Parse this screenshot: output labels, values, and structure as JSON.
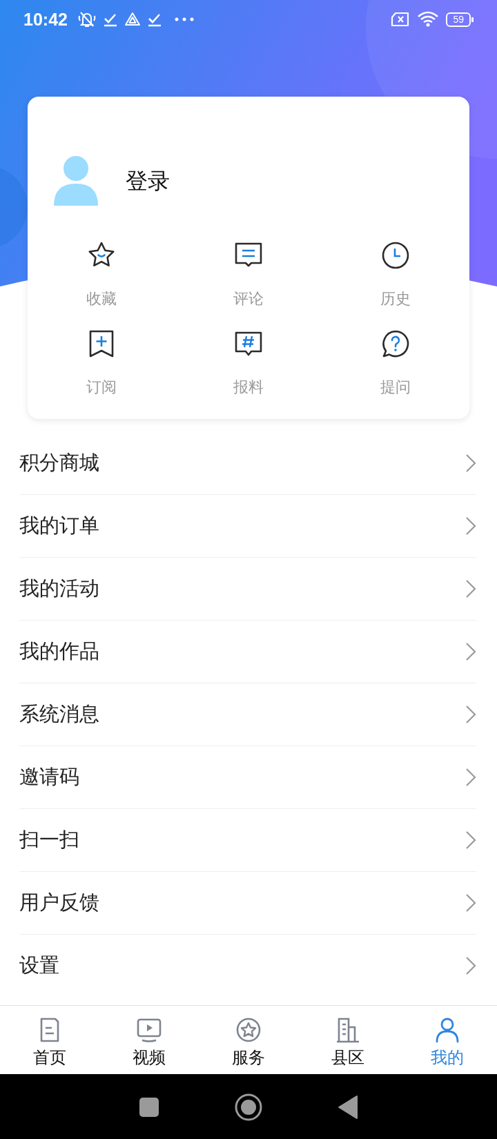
{
  "status_bar": {
    "time": "10:42",
    "battery": "59"
  },
  "profile": {
    "login": "登录"
  },
  "shortcuts": [
    {
      "label": "收藏"
    },
    {
      "label": "评论"
    },
    {
      "label": "历史"
    },
    {
      "label": "订阅"
    },
    {
      "label": "报料"
    },
    {
      "label": "提问"
    }
  ],
  "menu": [
    {
      "label": "积分商城"
    },
    {
      "label": "我的订单"
    },
    {
      "label": "我的活动"
    },
    {
      "label": "我的作品"
    },
    {
      "label": "系统消息"
    },
    {
      "label": "邀请码"
    },
    {
      "label": "扫一扫"
    },
    {
      "label": "用户反馈"
    },
    {
      "label": "设置"
    }
  ],
  "tab_bar": [
    {
      "label": "首页",
      "selected": false
    },
    {
      "label": "视频",
      "selected": false
    },
    {
      "label": "服务",
      "selected": false
    },
    {
      "label": "县区",
      "selected": false
    },
    {
      "label": "我的",
      "selected": true
    }
  ]
}
